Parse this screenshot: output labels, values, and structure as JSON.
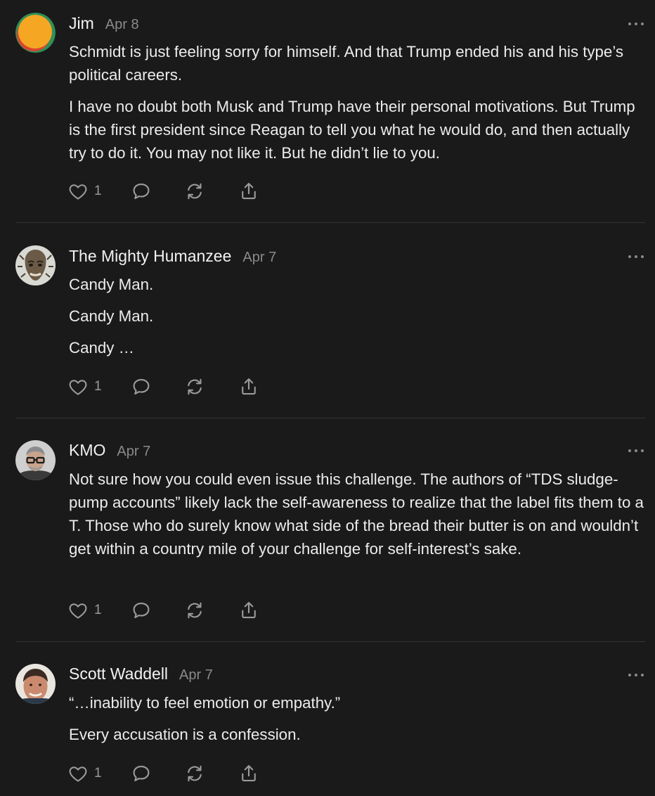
{
  "comments": [
    {
      "author": "Jim",
      "date": "Apr 8",
      "paragraphs": [
        "Schmidt is just feeling sorry for himself. And that Trump ended his and his type’s political careers.",
        "I have no doubt both Musk and Trump have their personal motivations. But Trump is the first president since Reagan to tell you what he would do, and then actually try to do it. You may not like it. But he didn’t lie to you."
      ],
      "likes": "1"
    },
    {
      "author": "The Mighty Humanzee",
      "date": "Apr 7",
      "paragraphs": [
        "Candy Man.",
        "Candy Man.",
        "Candy …"
      ],
      "likes": "1"
    },
    {
      "author": "KMO",
      "date": "Apr 7",
      "paragraphs": [
        "Not sure how you could even issue this challenge. The authors of “TDS sludge-pump accounts” likely lack the self-awareness to realize that the label fits them to a T. Those who do surely know what side of the bread their butter is on and wouldn’t get within a country mile of your challenge for self-interest’s sake."
      ],
      "likes": "1"
    },
    {
      "author": "Scott Waddell",
      "date": "Apr 7",
      "paragraphs": [
        "“…inability to feel emotion or empathy.”",
        "Every accusation is a confession."
      ],
      "likes": "1"
    }
  ],
  "icons": {
    "like": "heart-icon",
    "reply": "speech-bubble-icon",
    "restack": "restack-icon",
    "share": "share-icon",
    "more": "more-options-icon"
  },
  "colors": {
    "background": "#1a1a1a",
    "text": "#ececec",
    "muted": "#8a8a8a",
    "divider": "#333333"
  }
}
